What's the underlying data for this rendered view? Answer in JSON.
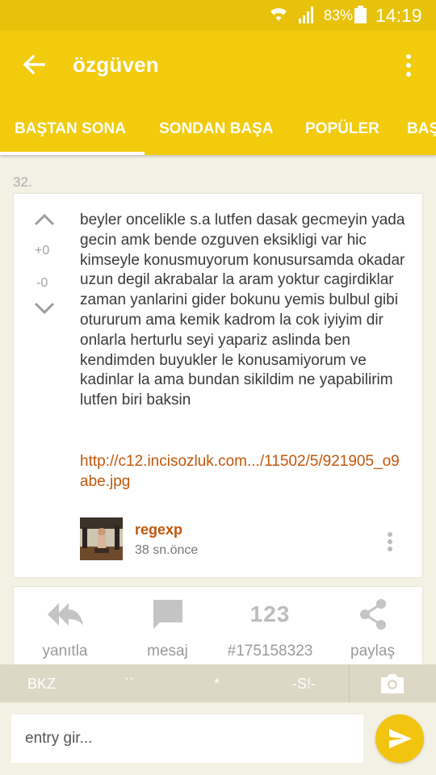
{
  "status_bar": {
    "battery": "83%",
    "time": "14:19"
  },
  "app_bar": {
    "title": "özgüven"
  },
  "tabs": [
    {
      "label": "BAŞTAN SONA",
      "active": true
    },
    {
      "label": "SONDAN BAŞA",
      "active": false
    },
    {
      "label": "POPÜLER",
      "active": false
    },
    {
      "label": "BAŞ",
      "active": false
    }
  ],
  "entry": {
    "number": "32.",
    "upvotes": "+0",
    "downvotes": "-0",
    "text": "beyler oncelikle s.a lutfen dasak gecmeyin yada gecin amk bende ozguven eksikligi var hic kimseyle konusmuyorum konusursamda okadar uzun degil akrabalar la aram yoktur cagirdiklar zaman yanlarini gider bokunu yemis bulbul gibi otururum ama kemik kadrom la cok iyiyim dir onlarla herturlu seyi yapariz aslinda ben kendimden buyukler le konusamiyorum ve kadinlar la ama bundan sikildim ne yapabilirim lutfen biri baksin",
    "link": "http://c12.incisozluk.com.../11502/5/921905_o9abe.jpg",
    "author": "regexp",
    "time_ago": "38 sn.önce"
  },
  "actions": [
    {
      "label": "yanıtla",
      "icon": "reply-all-icon"
    },
    {
      "label": "mesaj",
      "icon": "message-icon"
    },
    {
      "label": "#175158323",
      "icon": "number-icon",
      "icon_text": "123"
    },
    {
      "label": "paylaş",
      "icon": "share-icon"
    }
  ],
  "format_bar": {
    "bkz": "BKZ",
    "backticks": "``",
    "asterisk": "*",
    "spoiler": "-S!-"
  },
  "input": {
    "placeholder": "entry gir..."
  },
  "colors": {
    "primary": "#f2cb0c",
    "status_bar": "#e8c20a",
    "link": "#c2570a",
    "background": "#f3f0e4"
  }
}
